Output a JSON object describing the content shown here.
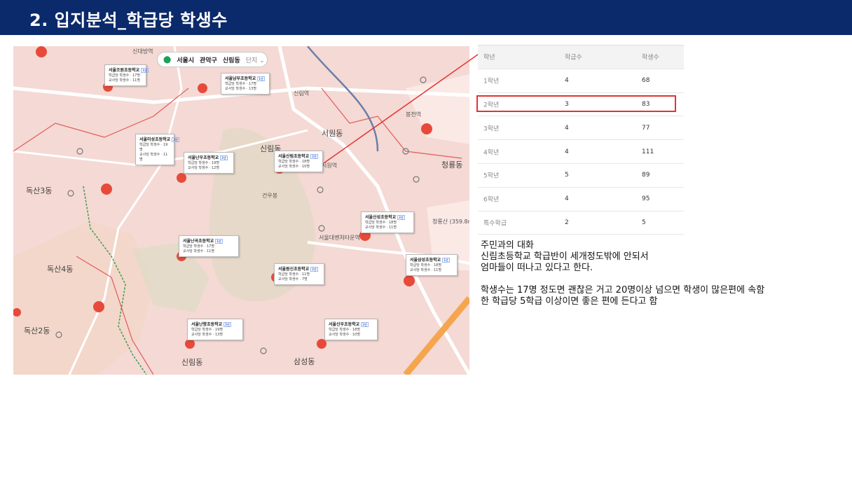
{
  "header": {
    "title": "2. 입지분석_학급당 학생수"
  },
  "map": {
    "pill": {
      "city": "서울시",
      "district": "관악구",
      "dong": "신림동",
      "mode": "단지"
    },
    "place_labels": [
      {
        "id": "sindaebang",
        "text": "신대방역"
      },
      {
        "id": "bongcheon",
        "text": "봉천역"
      },
      {
        "id": "seowon",
        "text": "서원동"
      },
      {
        "id": "sillim",
        "text": "신림동"
      },
      {
        "id": "sillim_st",
        "text": "신림역"
      },
      {
        "id": "cheongnyong",
        "text": "청룡동"
      },
      {
        "id": "doksan3",
        "text": "독산3동"
      },
      {
        "id": "doksan4",
        "text": "독산4동"
      },
      {
        "id": "doksan2",
        "text": "독산2동"
      },
      {
        "id": "samseong",
        "text": "삼성동"
      },
      {
        "id": "sillim_dong2",
        "text": "신림동"
      },
      {
        "id": "seowon_st",
        "text": "서원역"
      },
      {
        "id": "gwanak_uni",
        "text": "서울대벤처타운역"
      },
      {
        "id": "gunbong",
        "text": "건우봉"
      },
      {
        "id": "cheongnyongsan",
        "text": "청룡산 (359.8m)"
      }
    ],
    "schools": [
      {
        "name": "서울조원초등학교",
        "tag": "1년",
        "l1": "학급당 학생수 · 17명",
        "l2": "교사당 학생수 · 11명"
      },
      {
        "name": "서울남부초등학교",
        "tag": "1년",
        "l1": "학급당 학생수 · 17명",
        "l2": "교사당 학생수 · 13명"
      },
      {
        "name": "서울미성초등학교",
        "tag": "2년",
        "l1": "학급당 학생수 · 19명",
        "l2": "교사당 학생수 · 11명"
      },
      {
        "name": "서울난우초등학교",
        "tag": "2년",
        "l1": "학급당 학생수 · 19명",
        "l2": "교사당 학생수 · 12명"
      },
      {
        "name": "서울신림초등학교",
        "tag": "2년",
        "l1": "학급당 학생수 · 18명",
        "l2": "교사당 학생수 · 10명"
      },
      {
        "name": "서울신성초등학교",
        "tag": "2년",
        "l1": "학급당 학생수 · 18명",
        "l2": "교사당 학생수 · 11명"
      },
      {
        "name": "서울난곡초등학교",
        "tag": "1년",
        "l1": "학급당 학생수 · 17명",
        "l2": "교사당 학생수 · 11명"
      },
      {
        "name": "서울원신초등학교",
        "tag": "2년",
        "l1": "학급당 학생수 · 11명",
        "l2": "교사당 학생수 · 7명"
      },
      {
        "name": "서울삼성초등학교",
        "tag": "1년",
        "l1": "학급당 학생수 · 18명",
        "l2": "교사당 학생수 · 11명"
      },
      {
        "name": "서울난향초등학교",
        "tag": "2년",
        "l1": "학급당 학생수 · 19명",
        "l2": "교사당 학생수 · 13명"
      },
      {
        "name": "서울신우초등학교",
        "tag": "2년",
        "l1": "학급당 학생수 · 18명",
        "l2": "교사당 학생수 · 10명"
      }
    ]
  },
  "table": {
    "headers": [
      "학년",
      "학급수",
      "학생수"
    ],
    "rows": [
      [
        "1학년",
        "4",
        "68"
      ],
      [
        "2학년",
        "3",
        "83"
      ],
      [
        "3학년",
        "4",
        "77"
      ],
      [
        "4학년",
        "4",
        "111"
      ],
      [
        "5학년",
        "5",
        "89"
      ],
      [
        "6학년",
        "4",
        "95"
      ],
      [
        "특수학급",
        "2",
        "5"
      ]
    ],
    "highlight_row": "2학년",
    "highlight_color": "#e53232"
  },
  "notes": {
    "line1": "주민과의 대화",
    "line2": "신림초등학교 학급반이 세개정도밖에 안되서",
    "line3": "엄마들이 떠나고 있다고 한다.",
    "line4": "학생수는 17명 정도면 괜찮은 거고 20명이상 넘으면 학생이 많은편에 속함",
    "line5": "한 학급당 5학급 이상이면 좋은 편에 든다고 함"
  },
  "colors": {
    "header_bg": "#0b2a6b",
    "map_bg": "#f4d9d4",
    "arrow": "#e53232"
  }
}
